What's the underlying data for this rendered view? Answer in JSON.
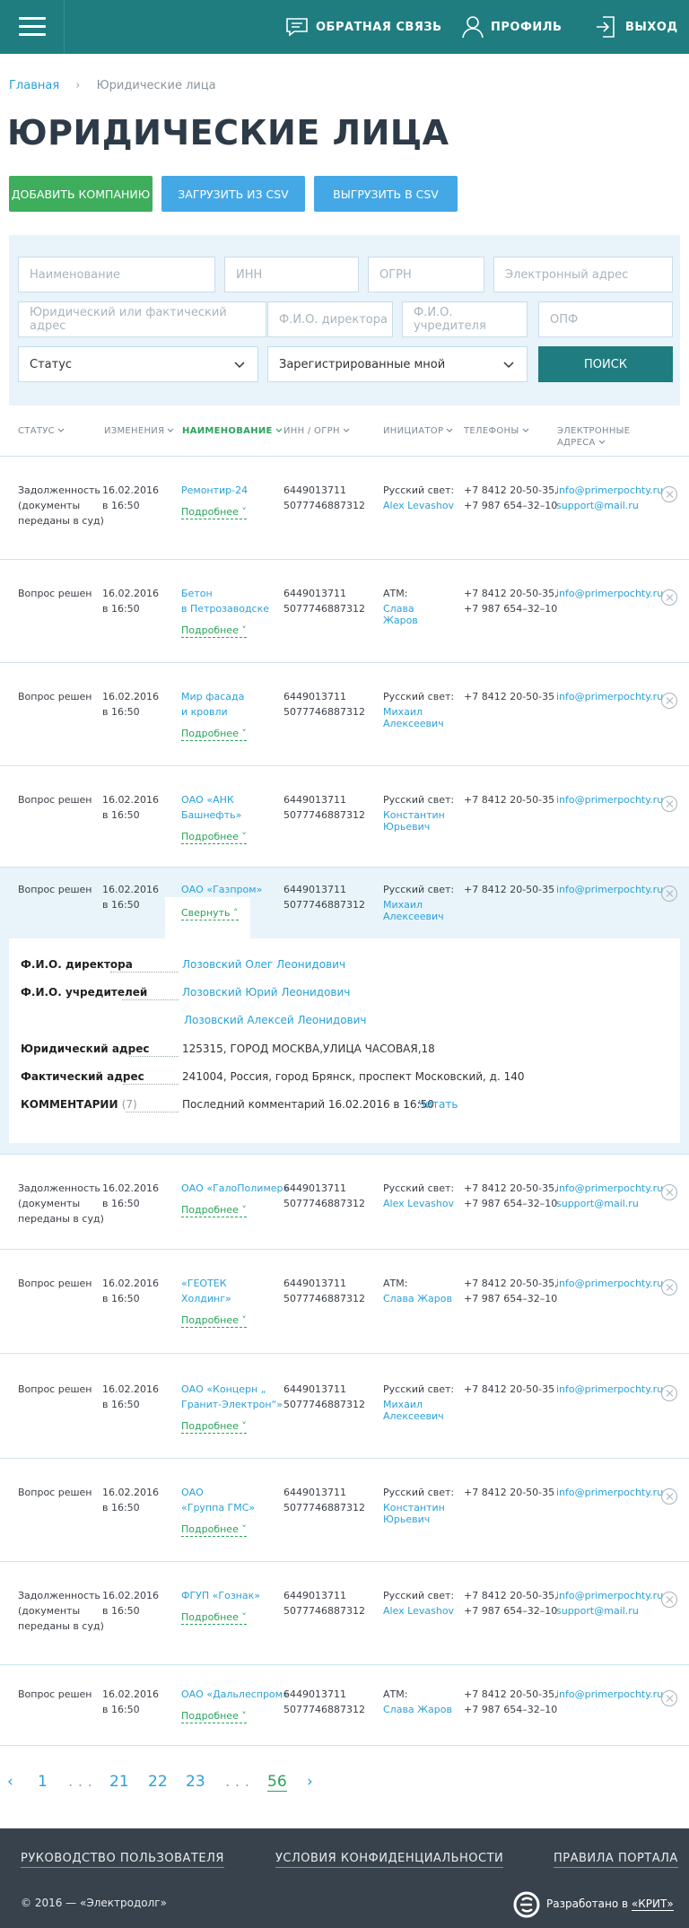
{
  "header": {
    "feedback": "ОБРАТНАЯ СВЯЗЬ",
    "profile": "ПРОФИЛЬ",
    "logout": "ВЫХОД"
  },
  "breadcrumb": {
    "home": "Главная",
    "current": "Юридические лица"
  },
  "page_title": "ЮРИДИЧЕСКИЕ ЛИЦА",
  "actions": {
    "add": "ДОБАВИТЬ КОМПАНИЮ",
    "upload": "ЗАГРУЗИТЬ ИЗ CSV",
    "download": "ВЫГРУЗИТЬ В CSV"
  },
  "filters": {
    "name": "Наименование",
    "inn": "ИНН",
    "ogrn": "ОГРН",
    "email": "Электронный адрес",
    "address": "Юридический или фактический адрес",
    "director": "Ф.И.О. директора",
    "founder": "Ф.И.О. учредителя",
    "opf": "ОПФ",
    "status": "Статус",
    "registered": "Зарегистрированные мной",
    "search": "ПОИСК"
  },
  "columns": {
    "status": "СТАТУС",
    "changes": "ИЗМЕНЕНИЯ",
    "name": "НАИМЕНОВАНИЕ",
    "inn": "ИНН / ОГРН",
    "initiator": "ИНИЦИАТОР",
    "phones": "ТЕЛЕФОНЫ",
    "emails": [
      "ЭЛЕКТРОННЫЕ",
      "АДРЕСА"
    ]
  },
  "common": {
    "date": "16.02.2016",
    "time": "в 16:50",
    "inn": "6449013711",
    "ogrn": "5077746887312",
    "more": "Подробнее",
    "collapse": "Свернуть",
    "phone1": "+7 8412 20-50-35,",
    "phone1b": "+7 8412 20-50-35",
    "phone2": "+7 987 654–32–10",
    "email1": "info@primerpochty.ru",
    "email2": "support@mail.ru",
    "status_court": [
      "Задолженность",
      "(документы",
      "переданы в суд)"
    ],
    "status_done": "Вопрос решен"
  },
  "rows": [
    {
      "name": [
        "Ремонтир-24"
      ],
      "org": "Русский свет:",
      "person": [
        "Alex Levashov"
      ]
    },
    {
      "name": [
        "Бетон",
        "в Петрозаводске"
      ],
      "org": "АТМ:",
      "person": [
        "Слава",
        "Жаров"
      ]
    },
    {
      "name": [
        "Мир фасада",
        "и кровли"
      ],
      "org": "Русский свет:",
      "person": [
        "Михаил",
        "Алексеевич"
      ]
    },
    {
      "name": [
        "ОАО «АНК",
        "Башнефть»"
      ],
      "org": "Русский свет:",
      "person": [
        "Константин",
        "Юрьевич"
      ]
    },
    {
      "name": [
        "ОАО «Газпром»"
      ],
      "org": "Русский свет:",
      "person": [
        "Михаил",
        "Алексеевич"
      ]
    },
    {
      "name": [
        "ОАО «ГалоПолимер»"
      ],
      "org": "Русский свет:",
      "person": [
        "Alex Levashov"
      ]
    },
    {
      "name": [
        "«ГЕОТЕК",
        "Холдинг»"
      ],
      "org": "АТМ:",
      "person": [
        "Слава Жаров"
      ]
    },
    {
      "name": [
        "ОАО «Концерн „",
        "Гранит-Электрон“»"
      ],
      "org": "Русский свет:",
      "person": [
        "Михаил",
        "Алексеевич"
      ]
    },
    {
      "name": [
        "ОАО",
        "«Группа ГМС»"
      ],
      "org": "Русский свет:",
      "person": [
        "Константин",
        "Юрьевич"
      ]
    },
    {
      "name": [
        "ФГУП «Гознак»"
      ],
      "org": "Русский свет:",
      "person": [
        "Alex Levashov"
      ]
    },
    {
      "name": [
        "ОАО «Дальлеспром»"
      ],
      "org": "АТМ:",
      "person": [
        "Слава Жаров"
      ]
    }
  ],
  "details": {
    "director_label": "Ф.И.О. директора",
    "director": "Лозовский Олег Леонидович",
    "founder_label": "Ф.И.О. учредителей",
    "founder1": "Лозовский Юрий Леонидович",
    "founder2": "Лозовский Алексей Леонидович",
    "legal_label": "Юридический адрес",
    "legal": "125315, ГОРОД МОСКВА,УЛИЦА ЧАСОВАЯ,18",
    "actual_label": "Фактический адрес",
    "actual": "241004, Россия, город Брянск, проспект Московский, д. 140",
    "comments_label": "КОММЕНТАРИИ",
    "comments_count": "(7)",
    "last_comment": "Последний комментарий 16.02.2016 в 16:50",
    "read": "Читать"
  },
  "pagination": {
    "p1": "1",
    "e1": ". . .",
    "p21": "21",
    "p22": "22",
    "p23": "23",
    "e2": ". . .",
    "p56": "56"
  },
  "footer": {
    "guide": "РУКОВОДСТВО ПОЛЬЗОВАТЕЛЯ",
    "privacy": "УСЛОВИЯ КОНФИДЕНЦИАЛЬНОСТИ",
    "rules": "ПРАВИЛА ПОРТАЛА",
    "copyright": "© 2016 — «Электродолг»",
    "dev_prefix": "Разработано в ",
    "dev_name": "«КРИТ»"
  }
}
